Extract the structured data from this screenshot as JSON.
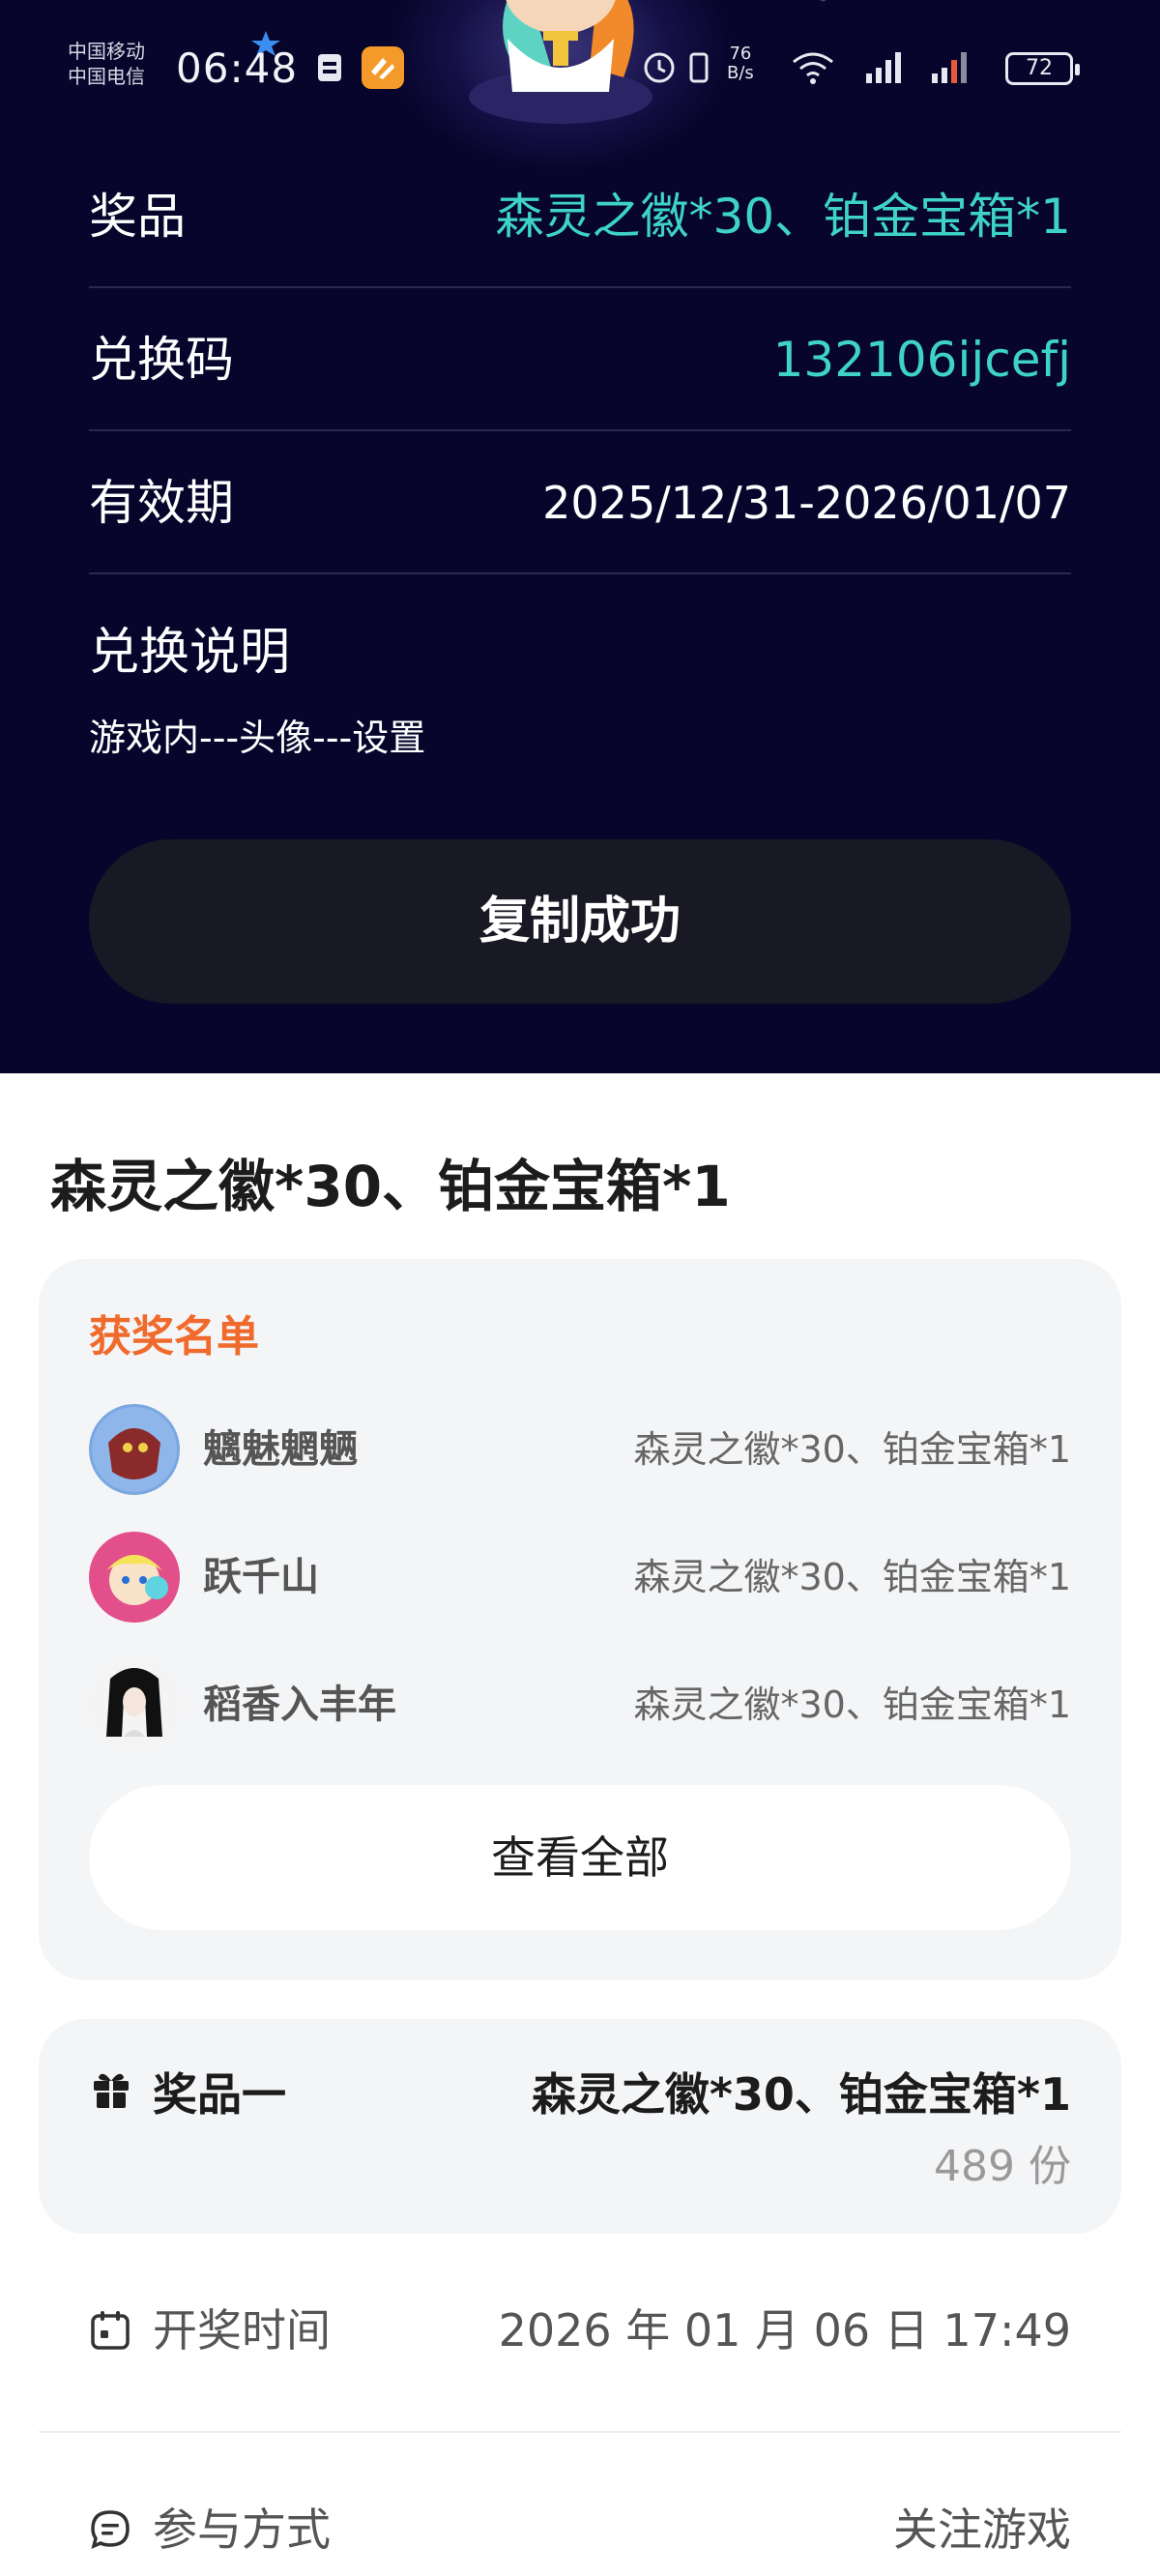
{
  "status_bar": {
    "carrier_line1": "中国移动",
    "carrier_line2": "中国电信",
    "time": "06:48",
    "net_speed_value": "76",
    "net_speed_unit": "B/s",
    "battery": "72"
  },
  "redeem_info": {
    "prize_label": "奖品",
    "prize_value": "森灵之徽*30、铂金宝箱*1",
    "code_label": "兑换码",
    "code_value": "132106ijcefj",
    "validity_label": "有效期",
    "validity_value": "2025/12/31-2026/01/07",
    "instructions_label": "兑换说明",
    "instructions_text": "游戏内---头像---设置",
    "copy_button": "复制成功"
  },
  "prize_title": "森灵之徽*30、铂金宝箱*1",
  "winners": {
    "title": "获奖名单",
    "list": [
      {
        "name": "魑魅魍魉",
        "prize": "森灵之徽*30、铂金宝箱*1"
      },
      {
        "name": "跃千山",
        "prize": "森灵之徽*30、铂金宝箱*1"
      },
      {
        "name": "稻香入丰年",
        "prize": "森灵之徽*30、铂金宝箱*1"
      }
    ],
    "view_all": "查看全部"
  },
  "prize_one": {
    "label": "奖品一",
    "value": "森灵之徽*30、铂金宝箱*1",
    "count": "489 份"
  },
  "draw_time": {
    "label": "开奖时间",
    "value": "2026 年 01 月 06 日 17:49"
  },
  "participation": {
    "label": "参与方式",
    "value": "关注游戏"
  },
  "colors": {
    "panel_bg": "#07052b",
    "teal": "#3ed3c6",
    "orange": "#f06a2c",
    "card_bg": "#f4f5f7"
  }
}
